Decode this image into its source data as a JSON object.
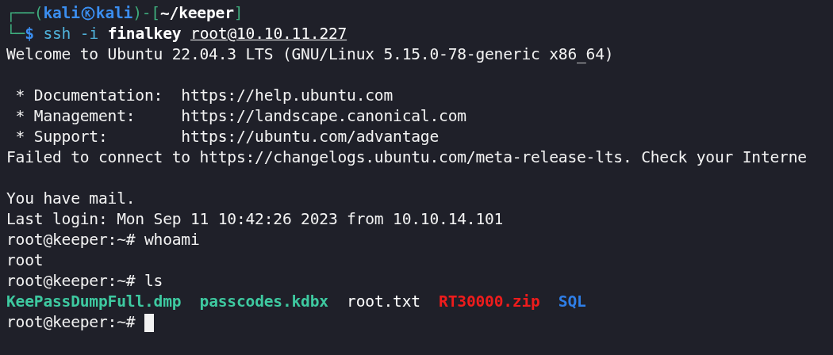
{
  "terminal": {
    "lines": [
      {
        "kind": "prompt_header",
        "open": "┌──(",
        "user": "kali",
        "host": "kali",
        "mid": ")-[",
        "cwd": "~/keeper",
        "close": "]"
      },
      {
        "kind": "command_line",
        "corner": "└─",
        "sigil": "$",
        "command": "ssh",
        "flag": "-i",
        "key": "finalkey",
        "target": "root@10.10.11.227"
      },
      {
        "kind": "output",
        "text": "Welcome to Ubuntu 22.04.3 LTS (GNU/Linux 5.15.0-78-generic x86_64)"
      },
      {
        "kind": "blank"
      },
      {
        "kind": "output",
        "text": " * Documentation:  https://help.ubuntu.com"
      },
      {
        "kind": "output",
        "text": " * Management:     https://landscape.canonical.com"
      },
      {
        "kind": "output",
        "text": " * Support:        https://ubuntu.com/advantage"
      },
      {
        "kind": "output",
        "text": "Failed to connect to https://changelogs.ubuntu.com/meta-release-lts. Check your Interne"
      },
      {
        "kind": "blank"
      },
      {
        "kind": "output",
        "text": "You have mail."
      },
      {
        "kind": "output",
        "text": "Last login: Mon Sep 11 10:42:26 2023 from 10.10.14.101"
      },
      {
        "kind": "shell_prompt",
        "prompt": "root@keeper:~#",
        "command": "whoami"
      },
      {
        "kind": "output",
        "text": "root"
      },
      {
        "kind": "shell_prompt",
        "prompt": "root@keeper:~#",
        "command": "ls"
      },
      {
        "kind": "listing",
        "entries": [
          {
            "name": "KeePassDumpFull.dmp",
            "color": "#3ec9a0",
            "bold": true
          },
          {
            "name": "passcodes.kdbx",
            "color": "#3ec9a0",
            "bold": true
          },
          {
            "name": "root.txt",
            "color": "#ffffff",
            "bold": false
          },
          {
            "name": "RT30000.zip",
            "color": "#ee1c1c",
            "bold": true
          },
          {
            "name": "SQL",
            "color": "#2f7fe8",
            "bold": true
          }
        ]
      },
      {
        "kind": "shell_prompt",
        "prompt": "root@keeper:~#",
        "cursor": true
      }
    ]
  }
}
